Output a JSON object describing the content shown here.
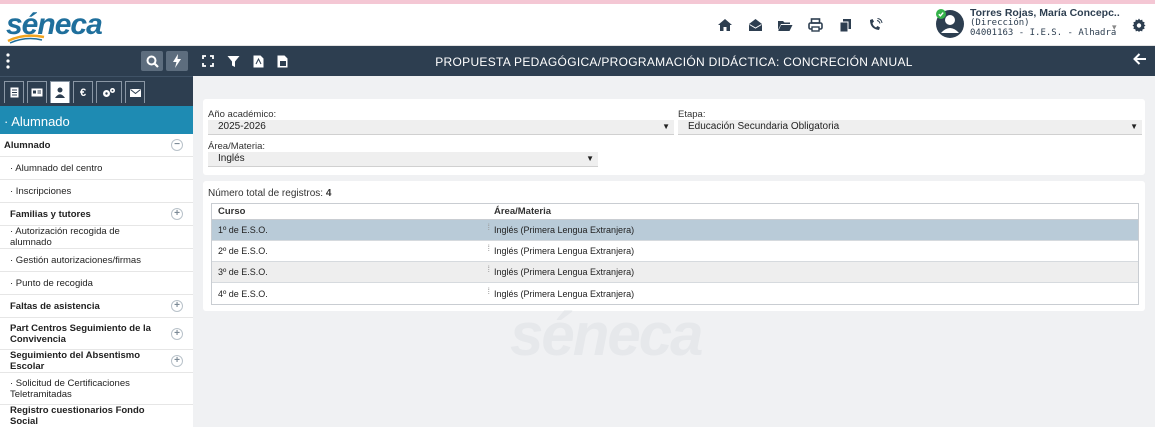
{
  "app": {
    "logo_text": "séneca",
    "watermark_text": "séneca"
  },
  "header": {
    "icons": [
      "home-icon",
      "envelope-open-icon",
      "folder-open-icon",
      "print-icon",
      "copy-icon",
      "phone-icon"
    ],
    "user": {
      "name": "Torres Rojas, María Concepc...",
      "role": "(Dirección)",
      "center": "04001163 - I.E.S. - Alhadra (..."
    }
  },
  "sidebar": {
    "section_title": "· Alumnado",
    "items": [
      {
        "label": "Alumnado",
        "type": "head",
        "toggle": "−"
      },
      {
        "label": "· Alumnado del centro",
        "type": "link"
      },
      {
        "label": "· Inscripciones",
        "type": "link"
      },
      {
        "label": "Familias y tutores",
        "type": "group",
        "toggle": "+"
      },
      {
        "label": "· Autorización recogida de alumnado",
        "type": "link"
      },
      {
        "label": "· Gestión autorizaciones/firmas",
        "type": "link"
      },
      {
        "label": "· Punto de recogida",
        "type": "link"
      },
      {
        "label": "Faltas de asistencia",
        "type": "group",
        "toggle": "+"
      },
      {
        "label": "Part Centros Seguimiento de la Convivencia",
        "type": "group",
        "toggle": "+"
      },
      {
        "label": "Seguimiento del Absentismo Escolar",
        "type": "group",
        "toggle": "+"
      },
      {
        "label": "· Solicitud de Certificaciones Teletramitadas",
        "type": "link"
      },
      {
        "label": "Registro cuestionarios Fondo Social",
        "type": "group"
      }
    ]
  },
  "toolbar": {
    "title": "PROPUESTA PEDAGÓGICA/PROGRAMACIÓN DIDÁCTICA: CONCRECIÓN ANUAL"
  },
  "filters": {
    "year_label": "Año académico:",
    "year_value": "2025-2026",
    "stage_label": "Etapa:",
    "stage_value": "Educación Secundaria Obligatoria",
    "subject_label": "Área/Materia:",
    "subject_value": "Inglés"
  },
  "results": {
    "count_label": "Número total de registros:",
    "count_value": "4",
    "columns": [
      "Curso",
      "Área/Materia"
    ],
    "rows": [
      {
        "curso": "1º de E.S.O.",
        "materia": "Inglés (Primera Lengua Extranjera)"
      },
      {
        "curso": "2º de E.S.O.",
        "materia": "Inglés (Primera Lengua Extranjera)"
      },
      {
        "curso": "3º de E.S.O.",
        "materia": "Inglés (Primera Lengua Extranjera)"
      },
      {
        "curso": "4º de E.S.O.",
        "materia": "Inglés (Primera Lengua Extranjera)"
      }
    ]
  },
  "colors": {
    "navy": "#2d3e50",
    "accent_blue": "#1e8bb3",
    "selected_row": "#b9cbd8",
    "logo_blue": "#1f6f9c",
    "logo_swoosh": "#f2a51f",
    "avatar_badge": "#35b34a"
  }
}
